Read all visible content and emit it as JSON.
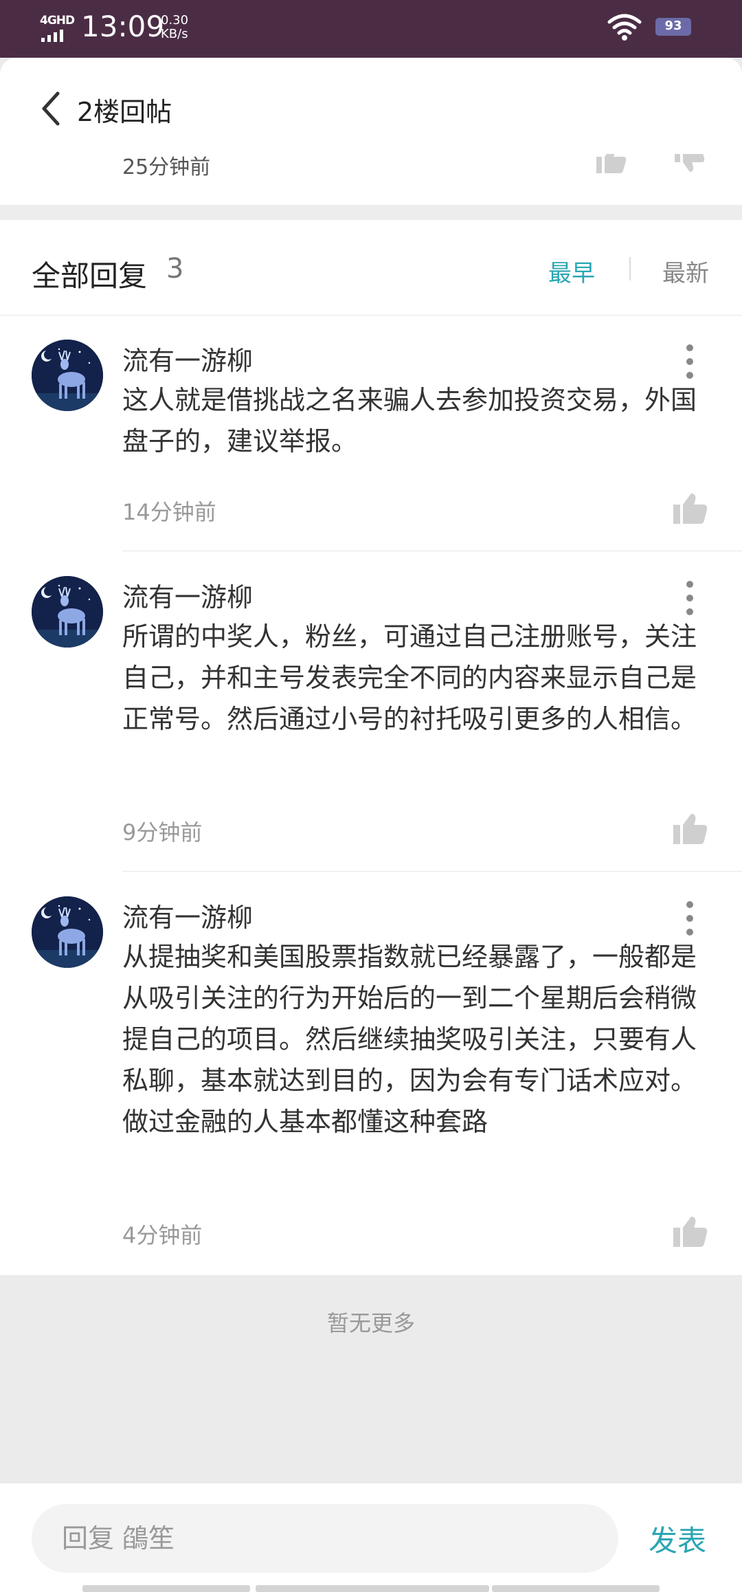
{
  "status_bar": {
    "network": "4GHD",
    "time": "13:09",
    "speed_value": "0.30",
    "speed_unit": "KB/s",
    "battery": "93"
  },
  "nav": {
    "title": "2楼回帖",
    "back_icon": "chevron-left-icon"
  },
  "previous_post": {
    "time": "25分钟前"
  },
  "replies_header": {
    "title": "全部回复",
    "count": "3",
    "sort_earliest": "最早",
    "sort_latest": "最新",
    "active_color": "#2aa6b3"
  },
  "replies": [
    {
      "author": "流有一游柳",
      "text": "这人就是借挑战之名来骗人去参加投资交易，外国盘子的，建议举报。",
      "time": "14分钟前"
    },
    {
      "author": "流有一游柳",
      "text": "所谓的中奖人，粉丝，可通过自己注册账号，关注自己，并和主号发表完全不同的内容来显示自己是正常号。然后通过小号的衬托吸引更多的人相信。",
      "time": "9分钟前"
    },
    {
      "author": "流有一游柳",
      "text": "从提抽奖和美国股票指数就已经暴露了，一般都是从吸引关注的行为开始后的一到二个星期后会稍微提自己的项目。然后继续抽奖吸引关注，只要有人私聊，基本就达到目的，因为会有专门话术应对。做过金融的人基本都懂这种套路",
      "time": "4分钟前"
    }
  ],
  "footer": {
    "no_more": "暂无更多"
  },
  "composer": {
    "placeholder": "回复 鵮笙",
    "send_label": "发表"
  }
}
